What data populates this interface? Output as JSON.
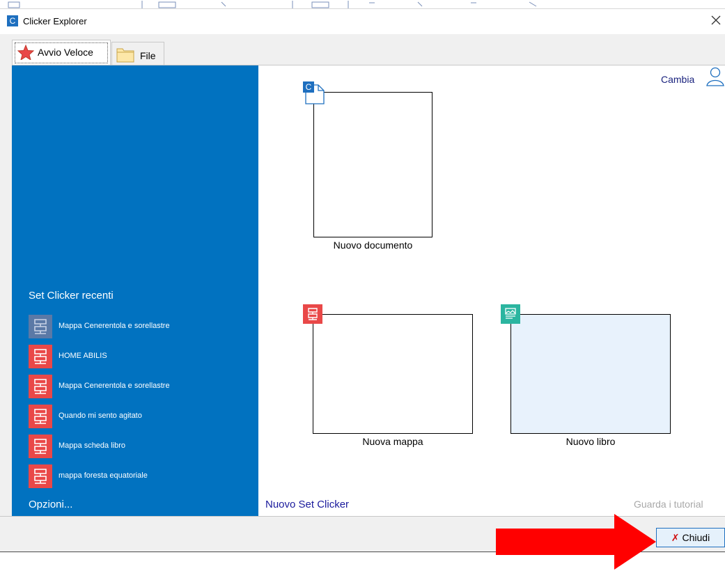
{
  "window": {
    "title": "Clicker Explorer",
    "app_icon_letter": "C"
  },
  "tabs": [
    {
      "label": "Avvio Veloce",
      "icon": "star-icon",
      "selected": true
    },
    {
      "label": "File",
      "icon": "folder-icon",
      "selected": false
    }
  ],
  "sidebar": {
    "heading": "Set Clicker recenti",
    "recent": [
      {
        "label": "Mappa Cenerentola e sorellastre",
        "icon": "map-icon",
        "color": "#5b79a6"
      },
      {
        "label": "HOME ABILIS",
        "icon": "map-icon",
        "color": "#e94848"
      },
      {
        "label": "Mappa Cenerentola e sorellastre",
        "icon": "map-icon",
        "color": "#e94848"
      },
      {
        "label": "Quando mi sento agitato",
        "icon": "map-icon",
        "color": "#e94848"
      },
      {
        "label": "Mappa scheda libro",
        "icon": "map-icon",
        "color": "#e94848"
      },
      {
        "label": "mappa foresta equatoriale",
        "icon": "map-icon",
        "color": "#e94848"
      }
    ],
    "options": "Opzioni..."
  },
  "main": {
    "change_user": "Cambia",
    "new_items": [
      {
        "label": "Nuovo documento",
        "icon": "document-icon",
        "badge_letter": "C",
        "color": "#1e6fbf"
      },
      {
        "label": "Nuova mappa",
        "icon": "map-icon",
        "color": "#e94848"
      },
      {
        "label": "Nuovo libro",
        "icon": "book-icon",
        "color": "#2bb5a0"
      }
    ],
    "new_set": "Nuovo Set Clicker",
    "tutorials": "Guarda i tutorial"
  },
  "footer": {
    "close_label": "Chiudi",
    "close_glyph": "✗"
  }
}
